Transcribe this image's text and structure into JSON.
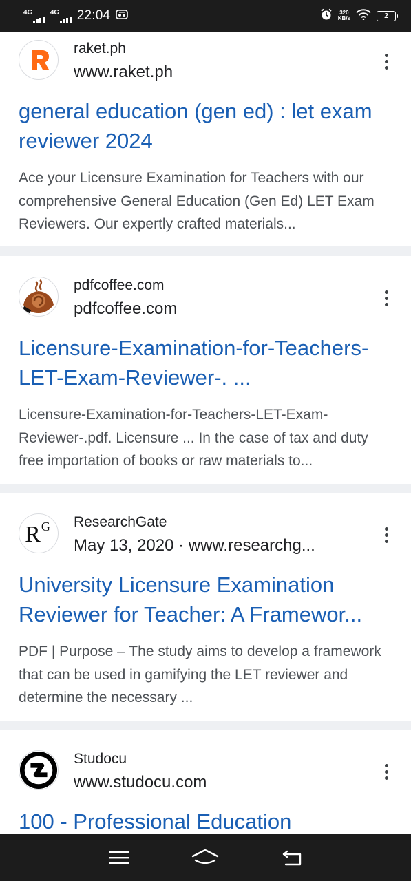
{
  "status_bar": {
    "network1": "4G",
    "network2": "4G",
    "time": "22:04",
    "speed_value": "320",
    "speed_unit": "KB/s",
    "battery": "2",
    "icons": [
      "signal-icon",
      "signal-icon",
      "notification-icon",
      "alarm-icon",
      "wifi-icon",
      "battery-icon"
    ]
  },
  "results": [
    {
      "site_name": "raket.ph",
      "url": "www.raket.ph",
      "title": "general education (gen ed) : let exam reviewer 2024",
      "snippet": "Ace your Licensure Examination for Teachers with our comprehensive General Education (Gen Ed) LET Exam Reviewers. Our expertly crafted materials...",
      "favicon": "raket-logo",
      "favicon_color": "#ff6a13"
    },
    {
      "site_name": "pdfcoffee.com",
      "url": "pdfcoffee.com",
      "title": "Licensure-Examination-for-Teachers-LET-Exam-Reviewer-. ...",
      "snippet": "Licensure-Examination-for-Teachers-LET-Exam-Reviewer-.pdf. Licensure ... In the case of tax and duty free importation of books or raw materials to...",
      "favicon": "coffee-cup-logo",
      "favicon_color": "#9a4a1e"
    },
    {
      "site_name": "ResearchGate",
      "url": "May 13, 2020 · www.researchg...",
      "title": "University Licensure Examination Reviewer for Teacher: A Framewor...",
      "snippet": "PDF | Purpose – The study aims to develop a framework that can be used in gamifying the LET reviewer and determine the necessary ...",
      "favicon": "researchgate-logo",
      "favicon_text": "R",
      "favicon_sup": "G"
    },
    {
      "site_name": "Studocu",
      "url": "www.studocu.com",
      "title": "100 - Professional Education",
      "snippet": "",
      "favicon": "studocu-logo"
    }
  ],
  "nav_bar": {
    "buttons": [
      "menu-icon",
      "home-icon",
      "back-icon"
    ]
  },
  "colors": {
    "link_blue": "#1a5fb4",
    "text_dark": "#202124",
    "snippet_gray": "#4d5156",
    "bar_dark": "#1c1c1c"
  }
}
